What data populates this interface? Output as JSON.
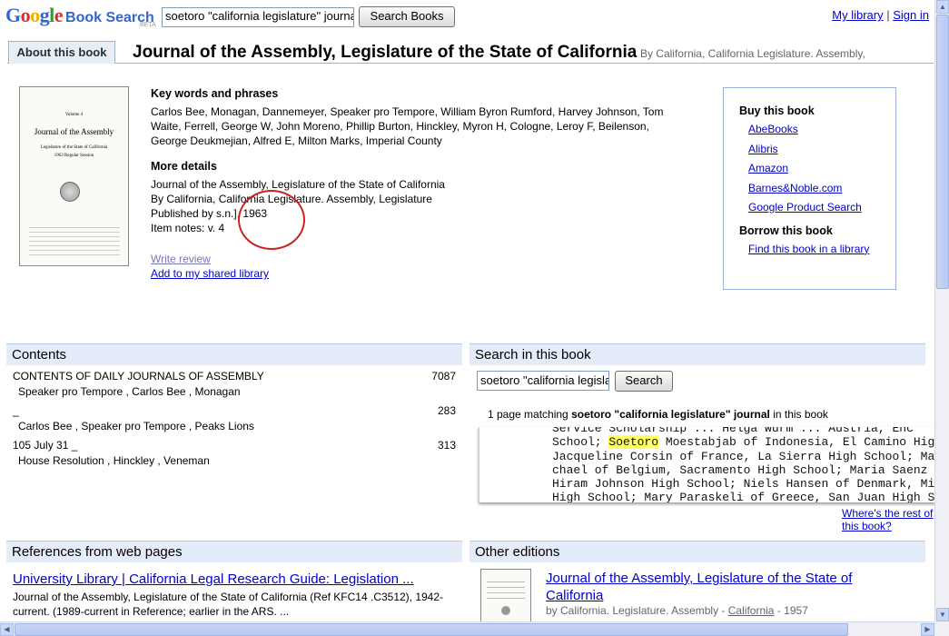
{
  "header": {
    "logo_google": "Google",
    "logo_product": "Book Search",
    "logo_beta": "BETA",
    "search_value": "soetoro \"california legislature\" journal",
    "search_button": "Search Books",
    "my_library": "My library",
    "separator": "|",
    "sign_in": "Sign in"
  },
  "tabs": {
    "about": "About this book"
  },
  "book": {
    "title": "Journal of the Assembly, Legislature of the State of California",
    "byline": "By California, California Legislature. Assembly,"
  },
  "cover": {
    "volume": "Volume 4",
    "title": "Journal of the Assembly",
    "subtitle": "Legislature of the State of California",
    "session": "1963 Regular Session"
  },
  "keywords": {
    "heading": "Key words and phrases",
    "text": "Carlos Bee, Monagan, Dannemeyer, Speaker pro Tempore, William Byron Rumford, Harvey Johnson, Tom Waite, Ferrell, George W, John Moreno, Phillip Burton, Hinckley, Myron H, Cologne, Leroy F, Beilenson, George Deukmejian, Alfred E, Milton Marks, Imperial County"
  },
  "more_details": {
    "heading": "More details",
    "line1": "Journal of the Assembly, Legislature of the State of California",
    "line2": "By California, California Legislature. Assembly, Legislature",
    "line3": "Published by s.n.], 1963",
    "line4": "Item notes: v. 4",
    "write_review": "Write review",
    "add_library": "Add to my shared library"
  },
  "buy": {
    "heading": "Buy this book",
    "stores": [
      "AbeBooks",
      "Alibris",
      "Amazon",
      "Barnes&Noble.com",
      "Google Product Search"
    ],
    "borrow_heading": "Borrow this book",
    "borrow_link": "Find this book in a library"
  },
  "contents": {
    "heading": "Contents",
    "rows": [
      {
        "title": "CONTENTS OF DAILY JOURNALS OF ASSEMBLY",
        "page": "7087",
        "sub": "Speaker pro Tempore , Carlos Bee , Monagan"
      },
      {
        "title": "_",
        "page": "283",
        "sub": "Carlos Bee , Speaker pro Tempore , Peaks Lions"
      },
      {
        "title": "105 July 31 _",
        "page": "313",
        "sub": "House Resolution , Hinckley , Veneman"
      }
    ]
  },
  "search_in_book": {
    "heading": "Search in this book",
    "input_value": "soetoro \"california legislature\" journal",
    "button": "Search",
    "match_prefix": "1 page matching",
    "match_query": "soetoro \"california legislature\" journal",
    "match_suffix": "in this book",
    "snippet_lines": [
      "Service Scholarship ... Helga Wurm ... Austria, Enc",
      "School; |Soetoro| Moestabjab of Indonesia, El Camino High S",
      "Jacqueline Corsin of France, La Sierra High School; Martin",
      "chael of Belgium, Sacramento High School; Maria Saenz of E",
      "Hiram Johnson High School; Niels Hansen of Denmark, Mir",
      "High School; Mary Paraskeli of Greece, San Juan High Scho"
    ],
    "wheres_rest": "Where's the rest of this book?"
  },
  "references": {
    "heading": "References from web pages",
    "link": "University Library | California Legal Research Guide: Legislation ...",
    "desc": "Journal of the Assembly, Legislature of the State of California (Ref KFC14 .C3512), 1942-current. (1989-current in Reference; earlier in the ARS. ..."
  },
  "other_editions": {
    "heading": "Other editions",
    "title": "Journal of the Assembly, Legislature of the State of California",
    "by_prefix": "by California. Legislature. Assembly -",
    "by_link": "California",
    "year": "- 1957"
  }
}
